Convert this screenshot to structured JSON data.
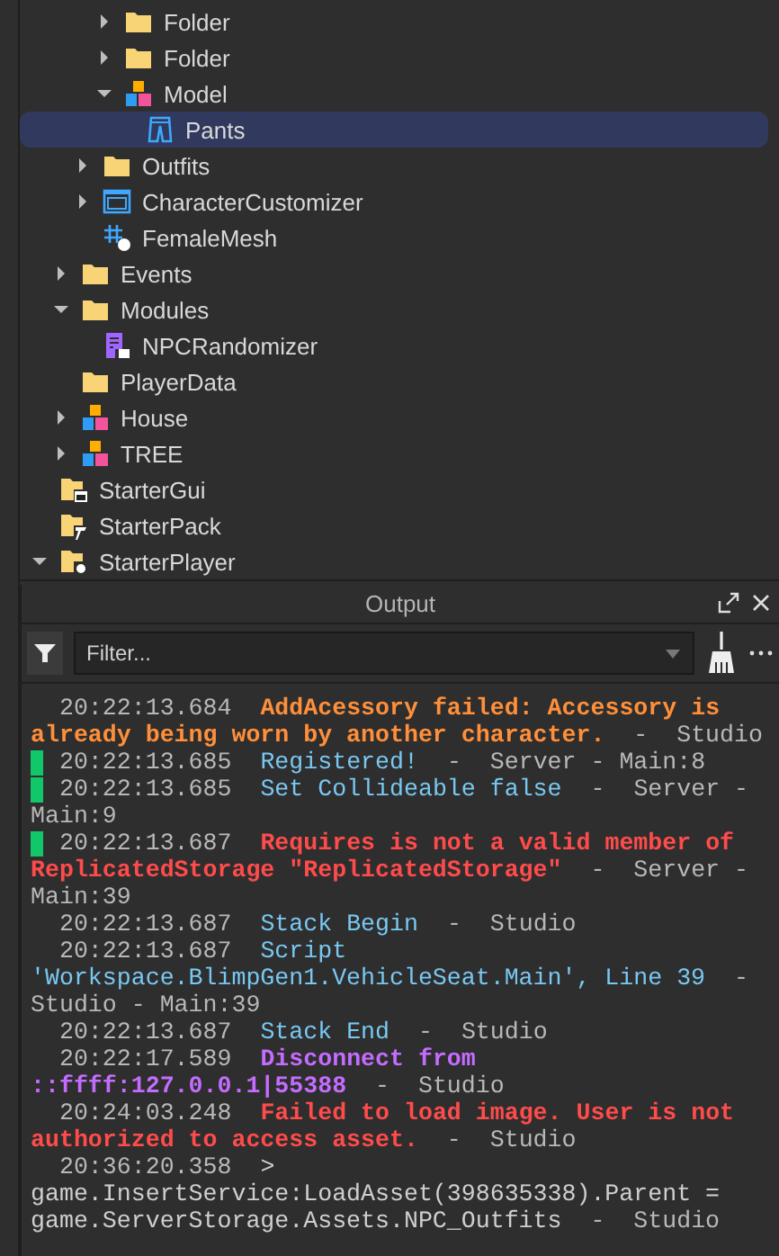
{
  "explorer": {
    "items": [
      {
        "children": [
          {
            "children": [
              {
                "children": [
                  {
                    "label": "Folder",
                    "kind": "folder",
                    "expanded": false,
                    "selected": false
                  },
                  {
                    "label": "Folder",
                    "kind": "folder",
                    "expanded": false,
                    "selected": false
                  },
                  {
                    "label": "Model",
                    "kind": "model",
                    "expanded": true,
                    "selected": false,
                    "children": [
                      {
                        "label": "Pants",
                        "kind": "pants",
                        "selected": true
                      }
                    ]
                  }
                ]
              },
              {
                "label": "Outfits",
                "kind": "folder",
                "expanded": false,
                "selected": false
              },
              {
                "label": "CharacterCustomizer",
                "kind": "screen",
                "expanded": false,
                "selected": false
              },
              {
                "label": "FemaleMesh",
                "kind": "mesh",
                "selected": false
              }
            ]
          },
          {
            "label": "Events",
            "kind": "folder",
            "expanded": false,
            "selected": false
          },
          {
            "label": "Modules",
            "kind": "folder",
            "expanded": true,
            "selected": false,
            "children": [
              {
                "label": "NPCRandomizer",
                "kind": "module",
                "selected": false
              }
            ]
          },
          {
            "label": "PlayerData",
            "kind": "folder",
            "selected": false
          },
          {
            "label": "House",
            "kind": "model",
            "expanded": false,
            "selected": false
          },
          {
            "label": "TREE",
            "kind": "model",
            "expanded": false,
            "selected": false
          }
        ]
      },
      {
        "label": "StarterGui",
        "kind": "startergui",
        "selected": false
      },
      {
        "label": "StarterPack",
        "kind": "starterpack",
        "selected": false
      },
      {
        "label": "StarterPlayer",
        "kind": "starterplayer",
        "expanded": true,
        "selected": false
      }
    ]
  },
  "output": {
    "title": "Output",
    "filter": {
      "placeholder": "Filter..."
    },
    "entries": [
      {
        "time": "20:22:13.684",
        "message": "AddAcessory failed: Accessory is already being worn by another character.",
        "kind": "warning",
        "source": "-  Studio",
        "marker": false
      },
      {
        "time": "20:22:13.685",
        "message": "Registered!",
        "kind": "info",
        "source": "-  Server - Main:8",
        "marker": true
      },
      {
        "time": "20:22:13.685",
        "message": "Set Collideable false",
        "kind": "info",
        "source": "-  Server - Main:9",
        "marker": true
      },
      {
        "time": "20:22:13.687",
        "message": "Requires is not a valid member of ReplicatedStorage \"ReplicatedStorage\"",
        "kind": "error",
        "source": "-  Server - Main:39",
        "marker": true
      },
      {
        "time": "20:22:13.687",
        "message": "Stack Begin",
        "kind": "info",
        "source": "-  Studio",
        "marker": false
      },
      {
        "time": "20:22:13.687",
        "message": "Script 'Workspace.BlimpGen1.VehicleSeat.Main', Line 39",
        "kind": "info",
        "source": "-  Studio - Main:39",
        "marker": false
      },
      {
        "time": "20:22:13.687",
        "message": "Stack End",
        "kind": "info",
        "source": "-  Studio",
        "marker": false
      },
      {
        "time": "20:22:17.589",
        "message": "Disconnect from ::ffff:127.0.0.1|55388",
        "kind": "network",
        "source": "-  Studio",
        "marker": false
      },
      {
        "time": "20:24:03.248",
        "message": "Failed to load image. User is not authorized to access asset.",
        "kind": "error",
        "source": "-  Studio",
        "marker": false
      },
      {
        "time": "20:36:20.358",
        "message": "> game.InsertService:LoadAsset(398635338).Parent = game.ServerStorage.Assets.NPC_Outfits",
        "kind": "command",
        "source": "-  Studio",
        "marker": false
      }
    ]
  }
}
